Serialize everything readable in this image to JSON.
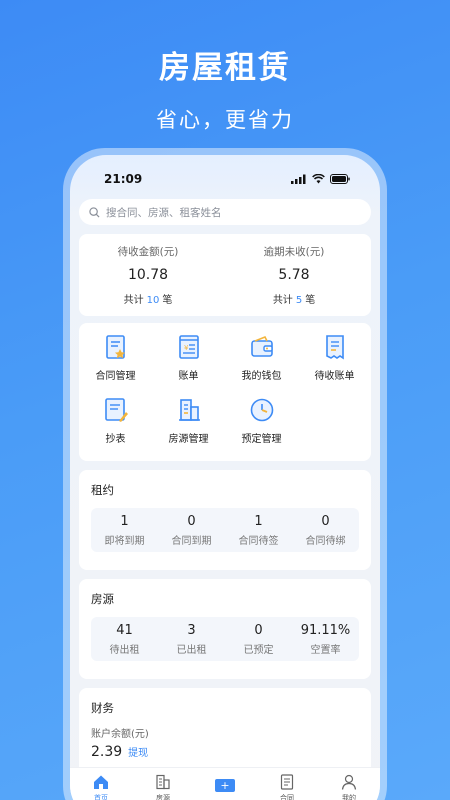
{
  "promo": {
    "title": "房屋租赁",
    "subtitle": "省心，更省力"
  },
  "status": {
    "time": "21:09"
  },
  "search": {
    "placeholder": "搜合同、房源、租客姓名"
  },
  "summary": [
    {
      "label": "待收金额(元)",
      "value": "10.78",
      "prefix": "共计",
      "count": "10",
      "suffix": "笔"
    },
    {
      "label": "逾期未收(元)",
      "value": "5.78",
      "prefix": "共计",
      "count": "5",
      "suffix": "笔"
    }
  ],
  "menu": [
    {
      "label": "合同管理",
      "icon": "contract-icon"
    },
    {
      "label": "账单",
      "icon": "bill-icon"
    },
    {
      "label": "我的钱包",
      "icon": "wallet-icon"
    },
    {
      "label": "待收账单",
      "icon": "pending-bill-icon"
    },
    {
      "label": "抄表",
      "icon": "meter-reading-icon"
    },
    {
      "label": "房源管理",
      "icon": "building-icon"
    },
    {
      "label": "预定管理",
      "icon": "clock-icon"
    }
  ],
  "lease": {
    "title": "租约",
    "stats": [
      {
        "value": "1",
        "label": "即将到期"
      },
      {
        "value": "0",
        "label": "合同到期"
      },
      {
        "value": "1",
        "label": "合同待签"
      },
      {
        "value": "0",
        "label": "合同待绑"
      }
    ]
  },
  "house": {
    "title": "房源",
    "stats": [
      {
        "value": "41",
        "label": "待出租"
      },
      {
        "value": "3",
        "label": "已出租"
      },
      {
        "value": "0",
        "label": "已预定"
      },
      {
        "value": "91.11%",
        "label": "空置率"
      }
    ]
  },
  "finance": {
    "title": "财务",
    "balance_label": "账户余额(元)",
    "balance": "2.39",
    "withdraw": "提现"
  },
  "tabs": [
    {
      "label": "首页",
      "icon": "home-icon",
      "active": true
    },
    {
      "label": "房源",
      "icon": "building-icon"
    },
    {
      "label": "+",
      "icon": "plus-icon"
    },
    {
      "label": "合同",
      "icon": "contract-icon"
    },
    {
      "label": "我的",
      "icon": "user-icon"
    }
  ],
  "colors": {
    "accent": "#3d8bf5",
    "icon_orange": "#f3b53c"
  }
}
